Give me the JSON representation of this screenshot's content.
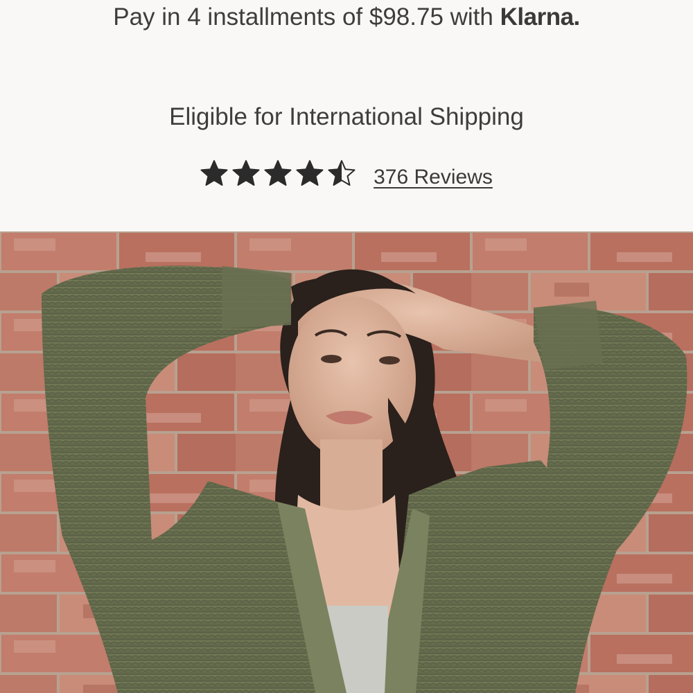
{
  "payment": {
    "installments_text": "Pay in 4 installments of $98.75 with",
    "provider": "Klarna."
  },
  "shipping": {
    "text": "Eligible for International Shipping"
  },
  "rating": {
    "stars": 4.5,
    "max_stars": 5,
    "reviews_label": "376 Reviews"
  },
  "product_image": {
    "icon": "product-photo",
    "alt": "Model wearing olive green knit cardigan against a brick wall"
  },
  "colors": {
    "text": "#3a3a38",
    "background": "#f9f8f6",
    "star": "#2b2b2b",
    "cardigan": "#6b7250"
  }
}
